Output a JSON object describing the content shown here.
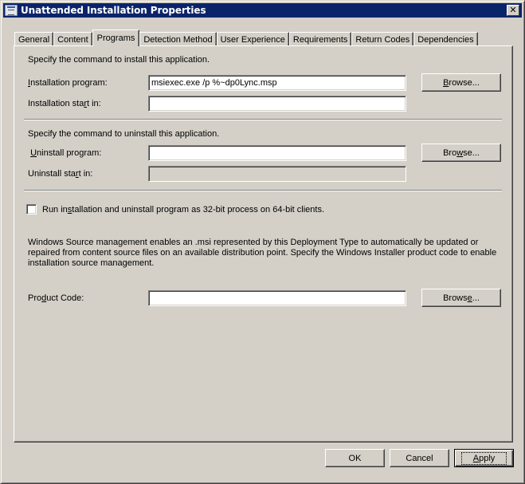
{
  "window": {
    "title": "Unattended Installation Properties",
    "close_label": "✕"
  },
  "tabs": [
    {
      "label": "General",
      "active": false
    },
    {
      "label": "Content",
      "active": false
    },
    {
      "label": "Programs",
      "active": true
    },
    {
      "label": "Detection Method",
      "active": false
    },
    {
      "label": "User Experience",
      "active": false
    },
    {
      "label": "Requirements",
      "active": false
    },
    {
      "label": "Return Codes",
      "active": false
    },
    {
      "label": "Dependencies",
      "active": false
    }
  ],
  "install": {
    "heading": "Specify the command to install this application.",
    "program_label_pre": "",
    "program_label_u": "I",
    "program_label_post": "nstallation program:",
    "program_value": "msiexec.exe /p %~dp0Lync.msp",
    "startin_label_pre": "Installation sta",
    "startin_label_u": "r",
    "startin_label_post": "t in:",
    "startin_value": "",
    "browse_pre": "",
    "browse_u": "B",
    "browse_post": "rowse..."
  },
  "uninstall": {
    "heading": "Specify the command to uninstall this application.",
    "program_label_pre": " ",
    "program_label_u": "U",
    "program_label_post": "ninstall program:",
    "program_value": "",
    "startin_label_pre": "Uninstall sta",
    "startin_label_u": "r",
    "startin_label_post": "t in:",
    "startin_value": "",
    "browse_pre": "Bro",
    "browse_u": "w",
    "browse_post": "se..."
  },
  "run32bit": {
    "checked": false,
    "label_pre": "Run in",
    "label_u": "s",
    "label_post": "tallation and uninstall program as 32-bit process on 64-bit clients."
  },
  "source_mgmt": {
    "description": "Windows Source management enables an .msi represented by this Deployment Type to automatically be updated or repaired from content source files on an available distribution point. Specify the Windows Installer product code to enable installation source management.",
    "product_code_label_pre": "Pro",
    "product_code_label_u": "d",
    "product_code_label_post": "uct Code:",
    "product_code_value": "",
    "browse_pre": "Brows",
    "browse_u": "e",
    "browse_post": "..."
  },
  "footer": {
    "ok_label": "OK",
    "cancel_label": "Cancel",
    "apply_u": "A",
    "apply_post": "pply"
  }
}
